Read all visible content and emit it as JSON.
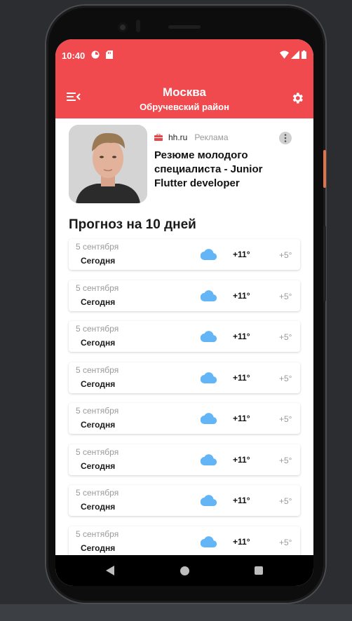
{
  "status_bar": {
    "time": "10:40",
    "icons": [
      "sync-icon",
      "sd-card-icon",
      "wifi-icon",
      "signal-icon",
      "battery-icon"
    ]
  },
  "app_bar": {
    "city": "Москва",
    "district": "Обручевский район",
    "menu_icon": "menu-collapse-icon",
    "settings_icon": "gear-icon"
  },
  "ad": {
    "brand": "hh.ru",
    "label": "Реклама",
    "title": "Резюме молодого специалиста - Junior Flutter developer",
    "more_icon": "more-vertical-icon",
    "brand_icon": "briefcase-icon"
  },
  "forecast": {
    "title": "Прогноз на 10 дней",
    "days": [
      {
        "date": "5 сентября",
        "day": "Сегодня",
        "icon": "cloud-icon",
        "max": "+11°",
        "min": "+5°"
      },
      {
        "date": "5 сентября",
        "day": "Сегодня",
        "icon": "cloud-icon",
        "max": "+11°",
        "min": "+5°"
      },
      {
        "date": "5 сентября",
        "day": "Сегодня",
        "icon": "cloud-icon",
        "max": "+11°",
        "min": "+5°"
      },
      {
        "date": "5 сентября",
        "day": "Сегодня",
        "icon": "cloud-icon",
        "max": "+11°",
        "min": "+5°"
      },
      {
        "date": "5 сентября",
        "day": "Сегодня",
        "icon": "cloud-icon",
        "max": "+11°",
        "min": "+5°"
      },
      {
        "date": "5 сентября",
        "day": "Сегодня",
        "icon": "cloud-icon",
        "max": "+11°",
        "min": "+5°"
      },
      {
        "date": "5 сентября",
        "day": "Сегодня",
        "icon": "cloud-icon",
        "max": "+11°",
        "min": "+5°"
      },
      {
        "date": "5 сентября",
        "day": "Сегодня",
        "icon": "cloud-icon",
        "max": "+11°",
        "min": "+5°"
      }
    ]
  },
  "colors": {
    "accent": "#f04a4f",
    "cloud": "#64b5f6",
    "muted_text": "#9a9a9a"
  }
}
